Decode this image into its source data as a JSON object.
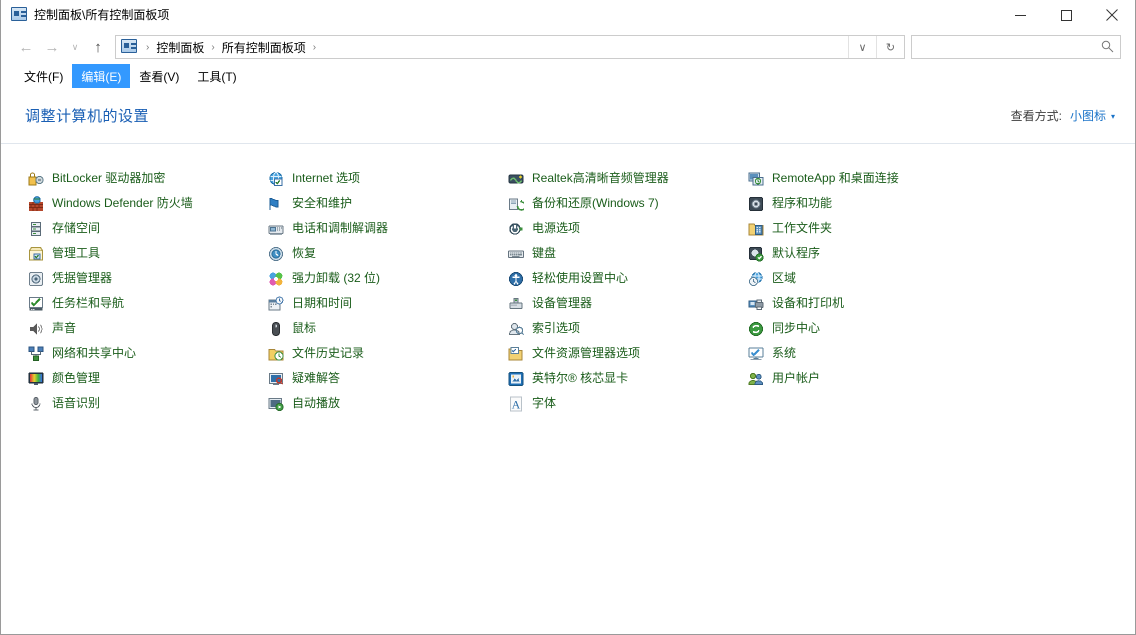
{
  "window": {
    "title": "控制面板\\所有控制面板项",
    "title_icon": "control-panel-icon",
    "minimize_label": "—",
    "maximize_label": "□",
    "close_label": "✕"
  },
  "toolbar": {
    "back_label": "←",
    "forward_label": "→",
    "recent_label": "∨",
    "up_label": "↑",
    "address_icon": "control-panel-icon",
    "breadcrumbs": [
      "控制面板",
      "所有控制面板项"
    ],
    "separator": "›",
    "dropdown_label": "∨",
    "refresh_label": "↻",
    "search_placeholder": "",
    "search_value": "",
    "search_icon": "search-icon"
  },
  "menu": {
    "items": [
      {
        "label": "文件(F)",
        "selected": false
      },
      {
        "label": "编辑(E)",
        "selected": true
      },
      {
        "label": "查看(V)",
        "selected": false
      },
      {
        "label": "工具(T)",
        "selected": false
      }
    ]
  },
  "header": {
    "page_title": "调整计算机的设置",
    "view_by_label": "查看方式:",
    "view_by_value": "小图标",
    "caret": "▾"
  },
  "colors": {
    "accent": "#3399ff",
    "title_blue": "#1a5fb4",
    "link_green": "#1a5c1a",
    "view_link": "#1a73c8"
  },
  "columns": [
    {
      "items": [
        {
          "label": "BitLocker 驱动器加密",
          "icon": "bitlocker-icon"
        },
        {
          "label": "Windows Defender 防火墙",
          "icon": "firewall-icon"
        },
        {
          "label": "存储空间",
          "icon": "storage-spaces-icon"
        },
        {
          "label": "管理工具",
          "icon": "administrative-tools-icon"
        },
        {
          "label": "凭据管理器",
          "icon": "credential-manager-icon"
        },
        {
          "label": "任务栏和导航",
          "icon": "taskbar-navigation-icon"
        },
        {
          "label": "声音",
          "icon": "sound-icon"
        },
        {
          "label": "网络和共享中心",
          "icon": "network-sharing-icon"
        },
        {
          "label": "颜色管理",
          "icon": "color-management-icon"
        },
        {
          "label": "语音识别",
          "icon": "speech-recognition-icon"
        }
      ]
    },
    {
      "items": [
        {
          "label": "Internet 选项",
          "icon": "internet-options-icon"
        },
        {
          "label": "安全和维护",
          "icon": "security-maintenance-icon"
        },
        {
          "label": "电话和调制解调器",
          "icon": "phone-modem-icon"
        },
        {
          "label": "恢复",
          "icon": "recovery-icon"
        },
        {
          "label": "强力卸载 (32 位)",
          "icon": "force-uninstall-icon"
        },
        {
          "label": "日期和时间",
          "icon": "date-time-icon"
        },
        {
          "label": "鼠标",
          "icon": "mouse-icon"
        },
        {
          "label": "文件历史记录",
          "icon": "file-history-icon"
        },
        {
          "label": "疑难解答",
          "icon": "troubleshooting-icon"
        },
        {
          "label": "自动播放",
          "icon": "autoplay-icon"
        }
      ]
    },
    {
      "items": [
        {
          "label": "Realtek高清晰音频管理器",
          "icon": "realtek-audio-icon"
        },
        {
          "label": "备份和还原(Windows 7)",
          "icon": "backup-restore-icon"
        },
        {
          "label": "电源选项",
          "icon": "power-options-icon"
        },
        {
          "label": "键盘",
          "icon": "keyboard-icon"
        },
        {
          "label": "轻松使用设置中心",
          "icon": "ease-of-access-icon"
        },
        {
          "label": "设备管理器",
          "icon": "device-manager-icon"
        },
        {
          "label": "索引选项",
          "icon": "indexing-options-icon"
        },
        {
          "label": "文件资源管理器选项",
          "icon": "file-explorer-options-icon"
        },
        {
          "label": "英特尔® 核芯显卡",
          "icon": "intel-graphics-icon"
        },
        {
          "label": "字体",
          "icon": "fonts-icon"
        }
      ]
    },
    {
      "items": [
        {
          "label": "RemoteApp 和桌面连接",
          "icon": "remoteapp-icon"
        },
        {
          "label": "程序和功能",
          "icon": "programs-features-icon"
        },
        {
          "label": "工作文件夹",
          "icon": "work-folders-icon"
        },
        {
          "label": "默认程序",
          "icon": "default-programs-icon"
        },
        {
          "label": "区域",
          "icon": "region-icon"
        },
        {
          "label": "设备和打印机",
          "icon": "devices-printers-icon"
        },
        {
          "label": "同步中心",
          "icon": "sync-center-icon"
        },
        {
          "label": "系统",
          "icon": "system-icon"
        },
        {
          "label": "用户帐户",
          "icon": "user-accounts-icon"
        }
      ]
    }
  ]
}
